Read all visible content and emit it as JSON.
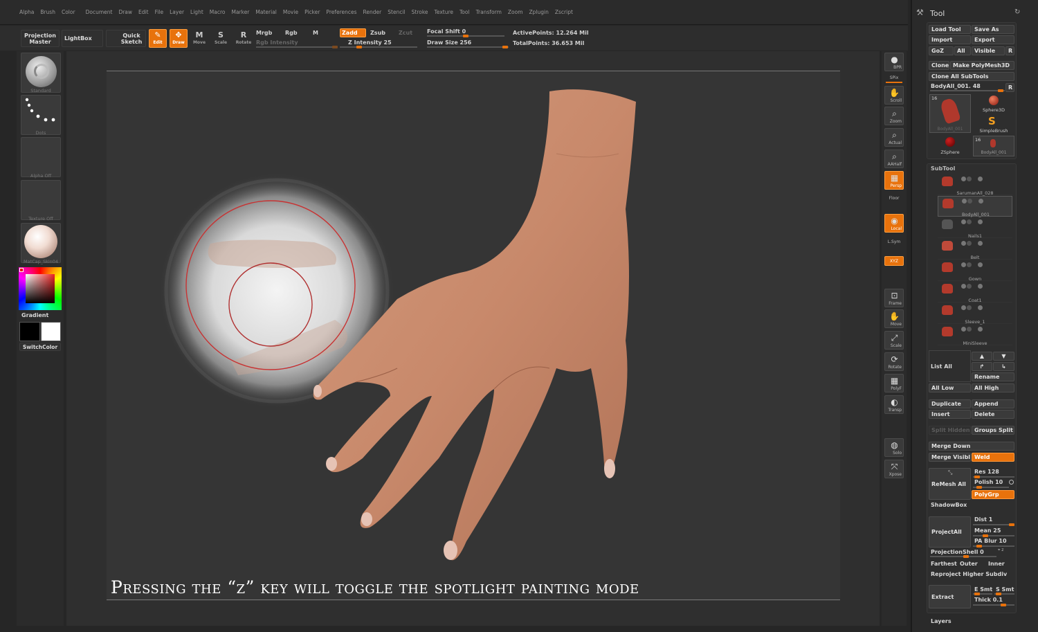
{
  "menubar": {
    "items": [
      "Alpha",
      "Brush",
      "Color",
      "Document",
      "Draw",
      "Edit",
      "File",
      "Layer",
      "Light",
      "Macro",
      "Marker",
      "Material",
      "Movie",
      "Picker",
      "Preferences",
      "Render",
      "Stencil",
      "Stroke",
      "Texture",
      "Tool",
      "Transform",
      "Zoom",
      "Zplugin",
      "Zscript"
    ]
  },
  "topbar": {
    "projection_master": "Projection Master",
    "lightbox": "LightBox",
    "quick_sketch": "Quick Sketch",
    "edit": "Edit",
    "draw": "Draw",
    "move": "Move",
    "scale": "Scale",
    "rotate": "Rotate",
    "mrgb": "Mrgb",
    "rgb": "Rgb",
    "m": "M",
    "rgb_intensity": "Rgb Intensity",
    "zadd": "Zadd",
    "zsub": "Zsub",
    "zcut": "Zcut",
    "z_intensity": "Z Intensity 25",
    "z_intensity_value": 25,
    "focal_shift": "Focal Shift 0",
    "focal_shift_value": 0,
    "draw_size": "Draw Size 256",
    "draw_size_value": 256,
    "active_points": "ActivePoints: 12.264 Mil",
    "total_points": "TotalPoints: 36.653 Mil"
  },
  "leftbar": {
    "brush": "Standard",
    "stroke": "Dots",
    "alpha": "Alpha Off",
    "texture": "Texture Off",
    "material": "MatCap_Skin04",
    "gradient": "Gradient",
    "switchcolor": "SwitchColor"
  },
  "shelf": [
    "BPR",
    "SPix",
    "Scroll",
    "Zoom",
    "Actual",
    "AAHalf",
    "Persp",
    "Floor",
    "Local",
    "L.Sym",
    "XYZ",
    "Frame",
    "Move",
    "Scale",
    "Rotate",
    "PolyF",
    "Transp",
    "Solo",
    "Xpose"
  ],
  "caption": "Pressing the “z” key will toggle the spotlight painting mode",
  "tool_panel": {
    "title": "Tool",
    "load_tool": "Load Tool",
    "save_as": "Save As",
    "import": "Import",
    "export": "Export",
    "goz": "GoZ",
    "all": "All",
    "visible": "Visible",
    "r": "R",
    "clone": "Clone",
    "make_polymesh": "Make PolyMesh3D",
    "clone_all": "Clone All SubTools",
    "current_tool": "BodyAll_001. 48",
    "thumbs": [
      {
        "name": "BodyAll_001",
        "count": "16"
      },
      {
        "name": "Sphere3D"
      },
      {
        "name": "SimpleBrush"
      },
      {
        "name": "ZSphere"
      },
      {
        "name": "BodyAll_001",
        "count": "16"
      }
    ],
    "subtool_header": "SubTool",
    "subtools": [
      "SarumanAll_028",
      "BodyAll_001",
      "Nails1",
      "Belt",
      "Gown",
      "Coat1",
      "Sleeve_1",
      "MiniSleeve"
    ],
    "list_all": "List All",
    "rename": "Rename",
    "all_low": "All Low",
    "all_high": "All High",
    "duplicate": "Duplicate",
    "append": "Append",
    "insert": "Insert",
    "delete": "Delete",
    "split_hidden": "Split Hidden",
    "groups_split": "Groups Split",
    "merge_down": "Merge Down",
    "merge_visible": "Merge Visible",
    "weld": "Weld",
    "remesh_all": "ReMesh All",
    "res": "Res 128",
    "polish": "Polish 10",
    "polygrp": "PolyGrp",
    "shadowbox": "ShadowBox",
    "project_all": "ProjectAll",
    "dist": "Dist 1",
    "mean": "Mean 25",
    "pa_blur": "PA Blur 10",
    "projection_shell": "ProjectionShell 0",
    "farthest": "Farthest",
    "outer": "Outer",
    "inner": "Inner",
    "reproject": "Reproject Higher Subdiv",
    "extract": "Extract",
    "e_smt": "E Smt",
    "s_smt": "S Smt",
    "thick": "Thick 0.1",
    "layers": "Layers"
  },
  "colors": {
    "accent": "#e8720c",
    "bg": "#262626",
    "skin": "#c98a6c"
  }
}
